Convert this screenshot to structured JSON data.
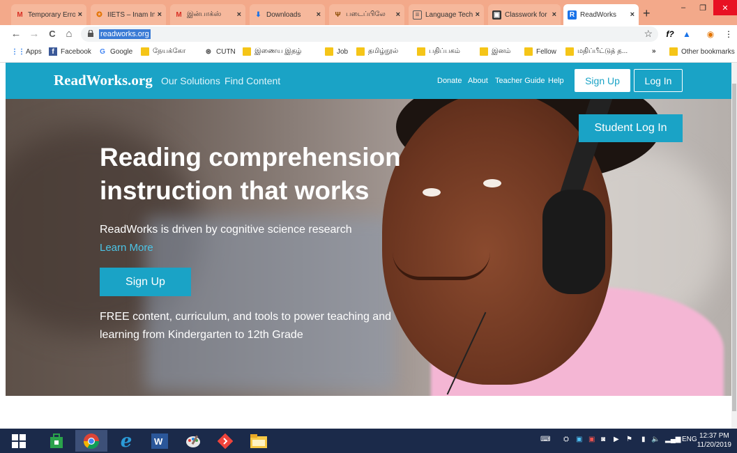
{
  "browser": {
    "tabs": [
      {
        "label": "Temporary Erro",
        "icon": "gmail-icon",
        "active": false
      },
      {
        "label": "IIETS – Inam Int",
        "icon": "site-icon",
        "active": false
      },
      {
        "label": "இன்பாக்ஸ்",
        "icon": "gmail-icon",
        "active": false
      },
      {
        "label": "Downloads",
        "icon": "download-icon",
        "active": false
      },
      {
        "label": "படைப்பிலே",
        "icon": "site-icon",
        "active": false
      },
      {
        "label": "Language Tech",
        "icon": "doc-icon",
        "active": false
      },
      {
        "label": "Classwork for",
        "icon": "classroom-icon",
        "active": false
      },
      {
        "label": "ReadWorks",
        "icon": "readworks-icon",
        "active": true
      }
    ],
    "tab_close": "×",
    "new_tab": "+",
    "window_controls": {
      "minimize": "–",
      "maximize": "❐",
      "close": "✕"
    },
    "nav": {
      "back": "←",
      "forward": "→",
      "reload": "C",
      "home": "⌂"
    },
    "url": "readworks.org",
    "star": "☆",
    "extensions": [
      "f?",
      "▲",
      "◉",
      "⋮"
    ],
    "bookmarks": [
      {
        "label": "Apps",
        "icon": "apps-icon"
      },
      {
        "label": "Facebook",
        "icon": "facebook-icon"
      },
      {
        "label": "Google",
        "icon": "google-icon"
      },
      {
        "label": "நேயக்கோ",
        "icon": "folder-icon"
      },
      {
        "label": "CUTN",
        "icon": "globe-icon"
      },
      {
        "label": "இணைய இதழ்",
        "icon": "folder-icon"
      },
      {
        "label": "Job",
        "icon": "folder-icon"
      },
      {
        "label": "தமிழ்நூல்",
        "icon": "folder-icon"
      },
      {
        "label": "பதிப்பகம்",
        "icon": "folder-icon"
      },
      {
        "label": "இனம்",
        "icon": "folder-icon"
      },
      {
        "label": "Fellow",
        "icon": "folder-icon"
      },
      {
        "label": "மதிப்பீட்டுத் த...",
        "icon": "folder-icon"
      }
    ],
    "bookmarks_more": "»",
    "other_bookmarks": "Other bookmarks"
  },
  "site": {
    "logo": "ReadWorks.org",
    "nav": {
      "our_solutions": "Our Solutions",
      "find_content": "Find Content"
    },
    "links": {
      "donate": "Donate",
      "about": "About",
      "teacher_guide": "Teacher Guide",
      "help": "Help"
    },
    "sign_up": "Sign Up",
    "log_in": "Log In",
    "hero": {
      "title_line1": "Reading comprehension",
      "title_line2": "instruction that works",
      "subtitle": "ReadWorks is driven by cognitive science research",
      "learn_more": "Learn More",
      "sign_up": "Sign Up",
      "free_text": "FREE content, curriculum, and tools to power teaching and learning from Kindergarten to 12th Grade",
      "student_login": "Student Log In"
    },
    "colors": {
      "brand": "#1aa3c6",
      "link": "#4cc4e6"
    }
  },
  "taskbar": {
    "apps": [
      "windows-start-icon",
      "store-icon",
      "chrome-icon",
      "ie-icon",
      "word-icon",
      "paint-icon",
      "anydesk-icon",
      "file-explorer-icon"
    ],
    "language": "ENG",
    "time": "12:37 PM",
    "date": "11/20/2019"
  }
}
